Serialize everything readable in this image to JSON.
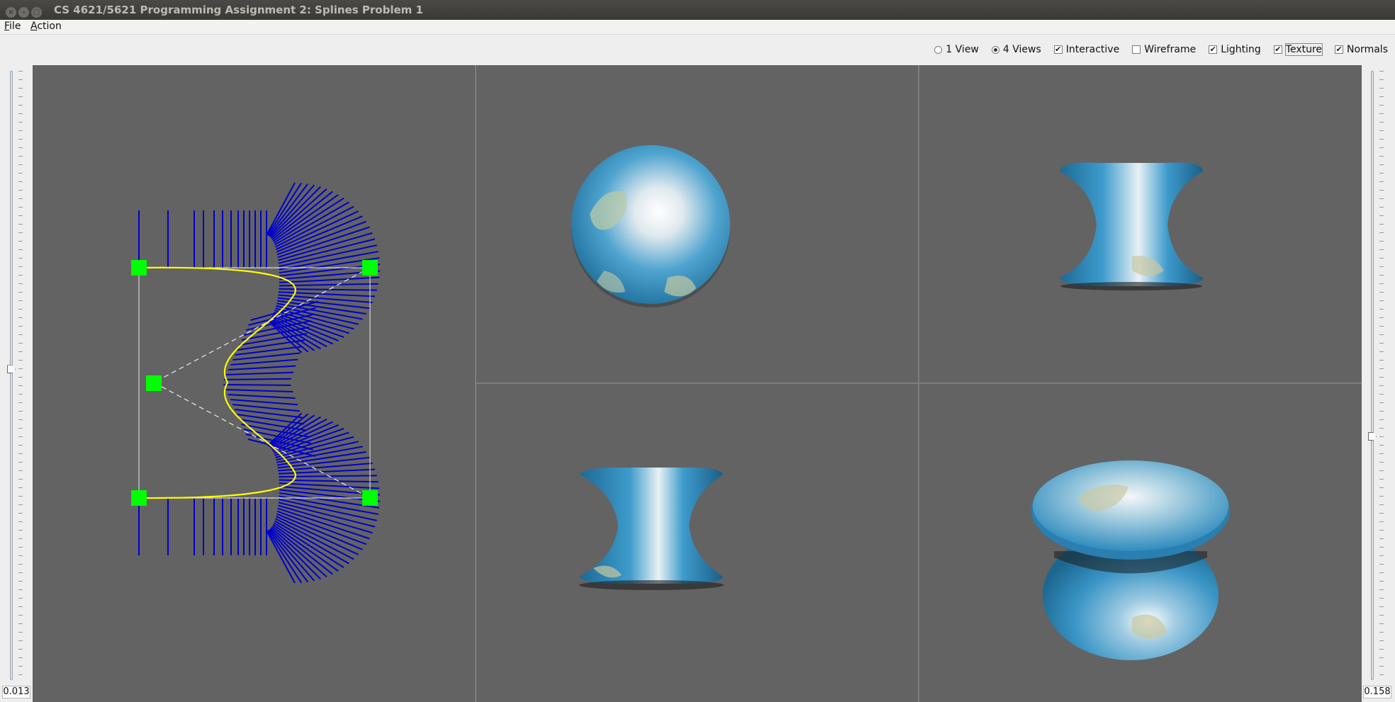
{
  "window": {
    "title": "CS 4621/5621 Programming Assignment 2: Splines Problem 1",
    "buttons": [
      "close-icon",
      "minimize-icon",
      "maximize-icon"
    ]
  },
  "menu": {
    "file": {
      "mnemonic": "F",
      "rest": "ile"
    },
    "action": {
      "mnemonic": "A",
      "rest": "ction"
    }
  },
  "toolbar": {
    "one_view": {
      "label": "1 View",
      "checked": false
    },
    "four_views": {
      "label": "4 Views",
      "checked": true
    },
    "interactive": {
      "label": "Interactive",
      "checked": true
    },
    "wireframe": {
      "label": "Wireframe",
      "checked": false
    },
    "lighting": {
      "label": "Lighting",
      "checked": true
    },
    "texture": {
      "label": "Texture",
      "checked": true
    },
    "normals": {
      "label": "Normals",
      "checked": true
    }
  },
  "sliders": {
    "left": {
      "value": "0.013",
      "level": 0.49
    },
    "right": {
      "value": "0.158",
      "level": 0.6
    }
  },
  "colors": {
    "viewport_bg": "#636363",
    "control_point": "#00ff00",
    "spline": "#ffff00",
    "normals": "#0000cc",
    "earth_ocean": "#2f8fc0"
  },
  "views": [
    "spline-editor",
    "top-view",
    "front-view",
    "side-view",
    "perspective-view"
  ]
}
